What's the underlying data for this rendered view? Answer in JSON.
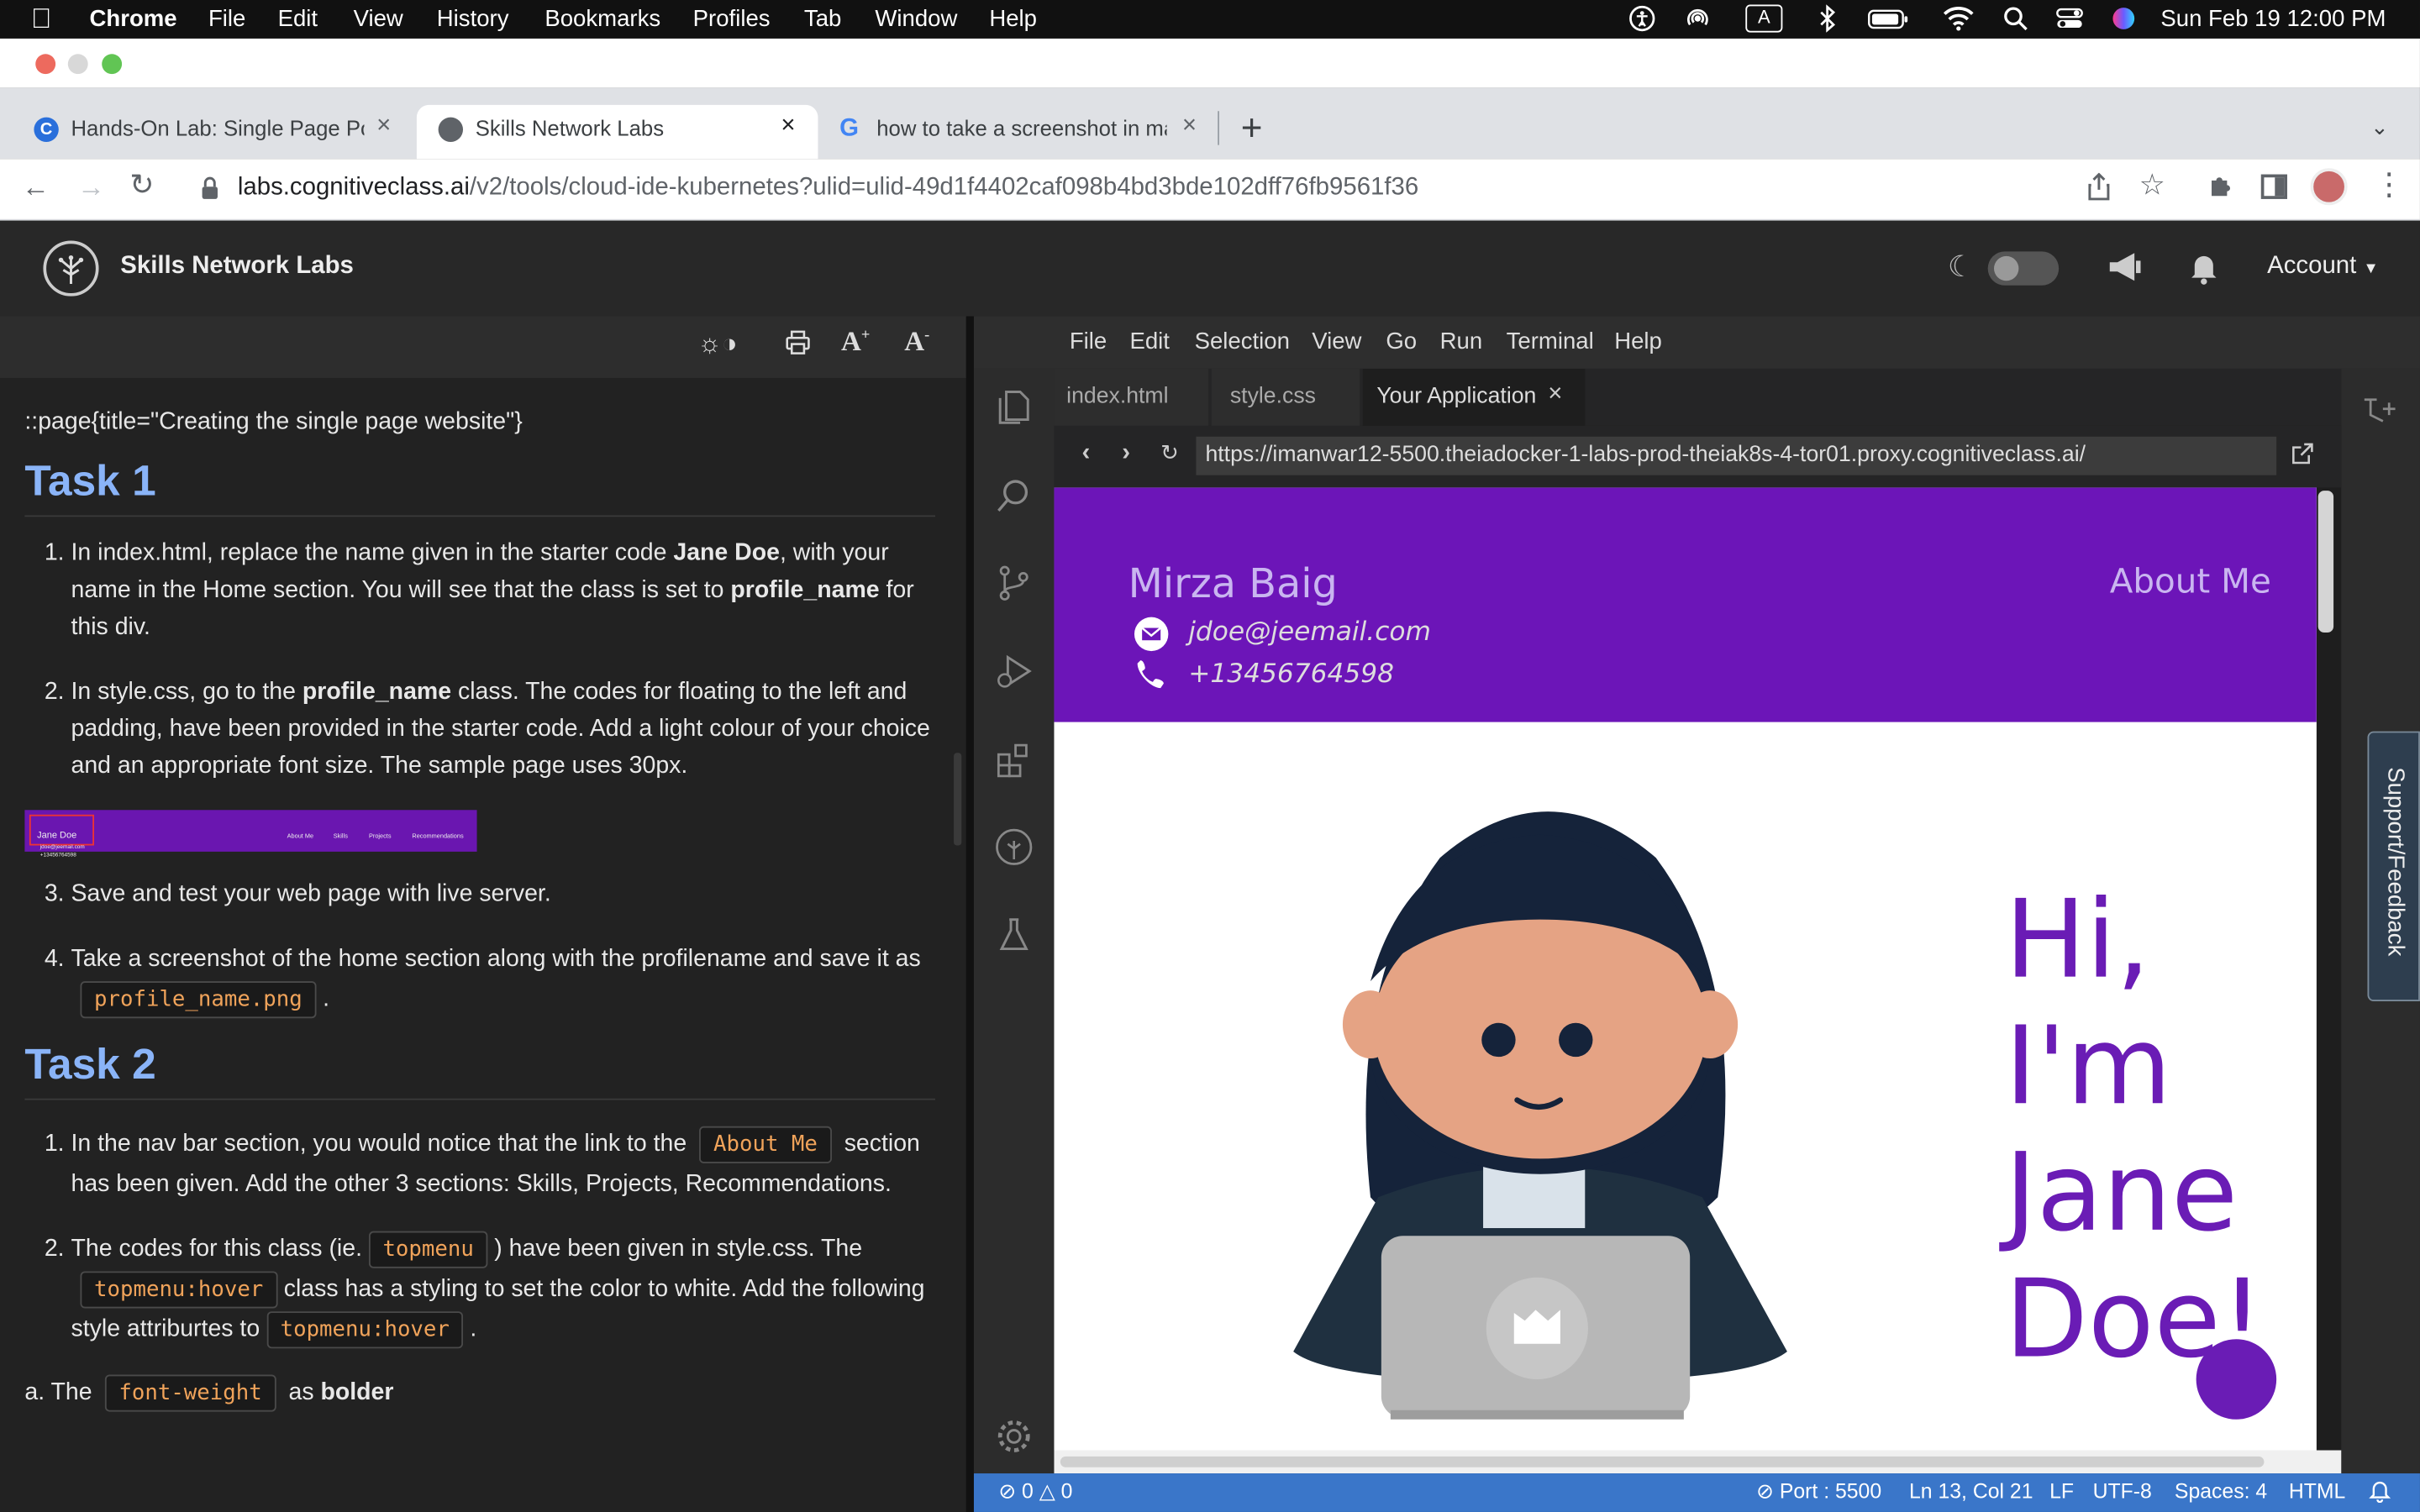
{
  "mac_menu": {
    "app": "Chrome",
    "items": [
      "File",
      "Edit",
      "View",
      "History",
      "Bookmarks",
      "Profiles",
      "Tab",
      "Window",
      "Help"
    ],
    "datetime": "Sun Feb 19  12:00 PM",
    "input_indicator": "A"
  },
  "chrome": {
    "tabs": [
      {
        "label": "Hands-On Lab: Single Page Po",
        "icon": "coursera-icon"
      },
      {
        "label": "Skills Network Labs",
        "icon": "skills-network-icon"
      },
      {
        "label": "how to take a screenshot in ma",
        "icon": "google-icon"
      }
    ],
    "url_host": "labs.cognitiveclass.ai",
    "url_path": "/v2/tools/cloud-ide-kubernetes?ulid=ulid-49d1f4402caf098b4bd3bde102dff76fb9561f36"
  },
  "sn_header": {
    "title": "Skills Network Labs",
    "account": "Account"
  },
  "instructions": {
    "page_directive": "::page{title=\"Creating the single page website\"}",
    "task1_title": "Task 1",
    "t1_s1_a": "In index.html, replace the name given in the starter code ",
    "t1_s1_b": "Jane Doe",
    "t1_s1_c": ", with your name in the Home section. You will see that the class is set to ",
    "t1_s1_d": "profile_name",
    "t1_s1_e": " for this div.",
    "t1_s2_a": "In style.css, go to the ",
    "t1_s2_b": "profile_name",
    "t1_s2_c": " class. The codes for floating to the left and padding, have been provided in the starter code. Add a light colour of your choice and an appropriate font size. The sample page uses 30px.",
    "t1_s3": "Save and test your web page with live server.",
    "t1_s4_a": "Take a screenshot of the home section along with the profilename and save it as",
    "t1_s4_code": "profile_name.png",
    "t1_s4_b": " .",
    "thumb": {
      "name": "Jane Doe",
      "email": "jdoe@jeemail.com",
      "phone": "+13456764598",
      "links": [
        "About Me",
        "Skills",
        "Projects",
        "Recommendations"
      ]
    },
    "task2_title": "Task 2",
    "t2_s1_a": "In the nav bar section, you would notice that the link to the",
    "t2_s1_code": "About Me",
    "t2_s1_b": " section has been given. Add the other 3 sections: Skills, Projects, Recommendations.",
    "t2_s2_a": "The codes for this class (ie. ",
    "t2_s2_code1": "topmenu",
    "t2_s2_b": " ) have been given in style.css. The",
    "t2_s2_code2": "topmenu:hover",
    "t2_s2_c": " class has a styling to set the color to white. Add the following style attriburtes to ",
    "t2_s2_code3": "topmenu:hover",
    "t2_s2_d": " .",
    "t2_a_prefix": "a. The",
    "t2_a_code": "font-weight",
    "t2_a_mid": " as ",
    "t2_a_bold": "bolder"
  },
  "ide": {
    "menu": [
      "File",
      "Edit",
      "Selection",
      "View",
      "Go",
      "Run",
      "Terminal",
      "Help"
    ],
    "tabs": [
      "index.html",
      "style.css",
      "Your Application"
    ],
    "preview_url": "https://imanwar12-5500.theiadocker-1-labs-prod-theiak8s-4-tor01.proxy.cognitiveclass.ai/",
    "status": {
      "errors": "0",
      "warnings": "0",
      "port": "Port : 5500",
      "position": "Ln 13, Col 21",
      "eol": "LF",
      "encoding": "UTF-8",
      "spaces": "Spaces: 4",
      "language": "HTML"
    },
    "support_label": "Support/Feedback"
  },
  "preview": {
    "name": "Mirza Baig",
    "email": "jdoe@jeemail.com",
    "phone": "+13456764598",
    "nav_about": "About Me",
    "hero_lines": [
      "Hi,",
      "I'm",
      "Jane",
      "Doe!"
    ],
    "colors": {
      "header_bg": "#6c15b8",
      "name": "#c9b5f0",
      "hero": "#6a1cb5"
    }
  }
}
